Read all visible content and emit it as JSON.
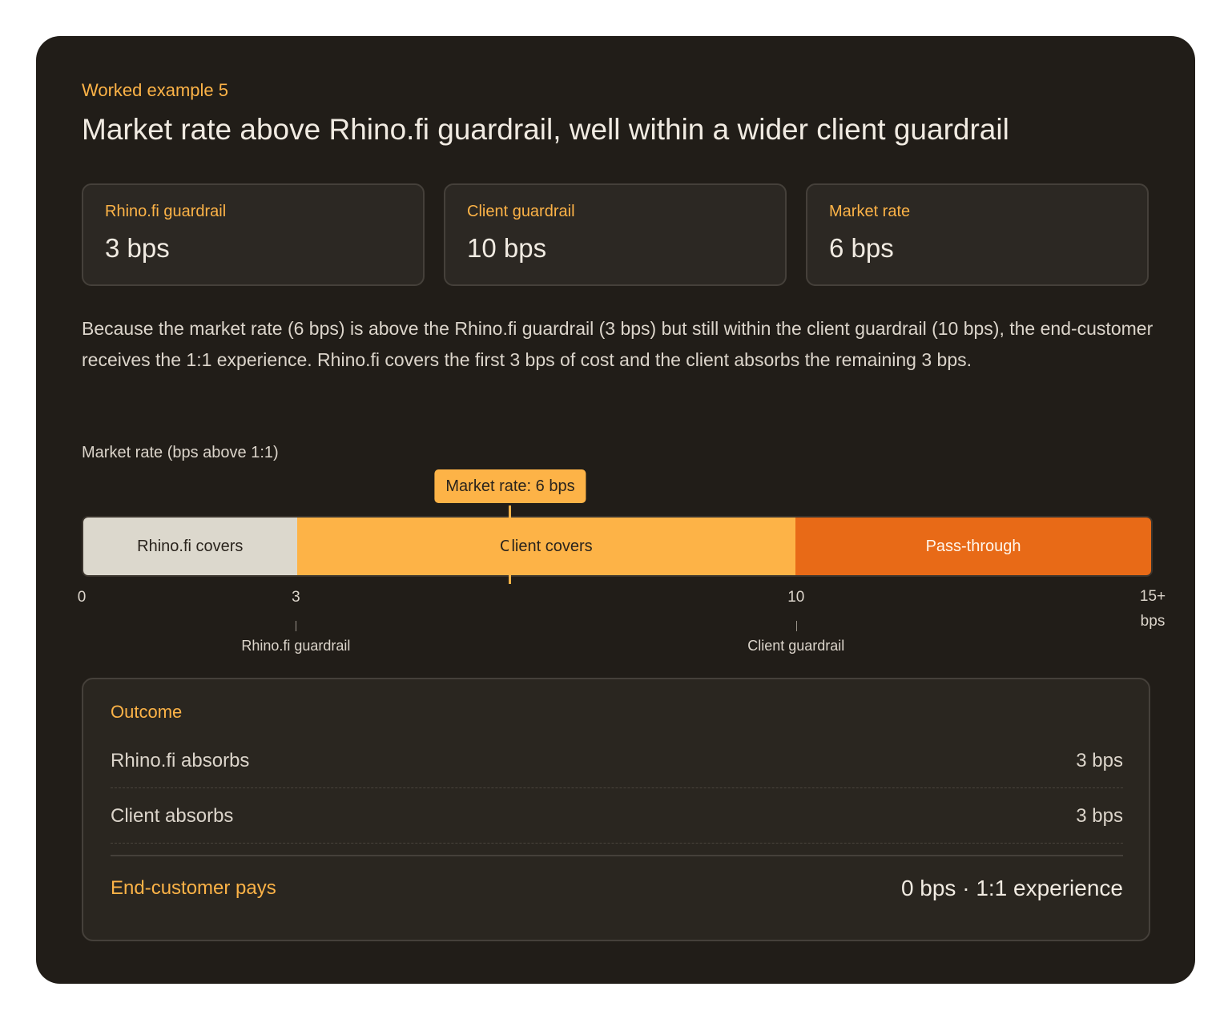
{
  "header": {
    "eyebrow": "Worked example 5",
    "title": "Market rate above Rhino.fi guardrail, well within a wider client guardrail"
  },
  "stats": [
    {
      "label": "Rhino.fi guardrail",
      "value": "3 bps"
    },
    {
      "label": "Client guardrail",
      "value": "10 bps"
    },
    {
      "label": "Market rate",
      "value": "6 bps"
    }
  ],
  "description": "Because the market rate (6 bps) is above the Rhino.fi guardrail (3 bps) but still within the client guardrail (10 bps), the end-customer receives the 1:1 experience. Rhino.fi covers the first 3 bps of cost and the client absorbs the remaining 3 bps.",
  "chart_data": {
    "type": "bar",
    "title": "Market rate (bps above 1:1)",
    "scale_min": 0,
    "scale_max": 15,
    "segments": [
      {
        "label": "Rhino.fi covers",
        "start": 0,
        "end": 3,
        "color": "#dcd8cd"
      },
      {
        "label": "Client covers",
        "start": 3,
        "end": 10,
        "color": "#fdb347"
      },
      {
        "label": "Pass-through",
        "start": 10,
        "end": 15,
        "color": "#e86a17"
      }
    ],
    "marker": {
      "label": "Market rate: 6 bps",
      "value": 6,
      "color": "#fdb347"
    },
    "ticks": [
      {
        "value": 0,
        "label": "0"
      },
      {
        "value": 3,
        "label": "3"
      },
      {
        "value": 10,
        "label": "10"
      },
      {
        "value": 15,
        "label": "15+",
        "sublabel": "bps"
      }
    ],
    "guardrails": [
      {
        "value": 3,
        "label": "Rhino.fi guardrail"
      },
      {
        "value": 10,
        "label": "Client guardrail"
      }
    ]
  },
  "outcome": {
    "title": "Outcome",
    "rows": [
      {
        "label": "Rhino.fi absorbs",
        "value": "3 bps"
      },
      {
        "label": "Client absorbs",
        "value": "3 bps"
      }
    ],
    "total": {
      "label": "End-customer pays",
      "value": "0 bps · 1:1 experience"
    }
  },
  "colors": {
    "accent": "#fdb347",
    "pass_through": "#e86a17",
    "card_background": "#211d18"
  }
}
